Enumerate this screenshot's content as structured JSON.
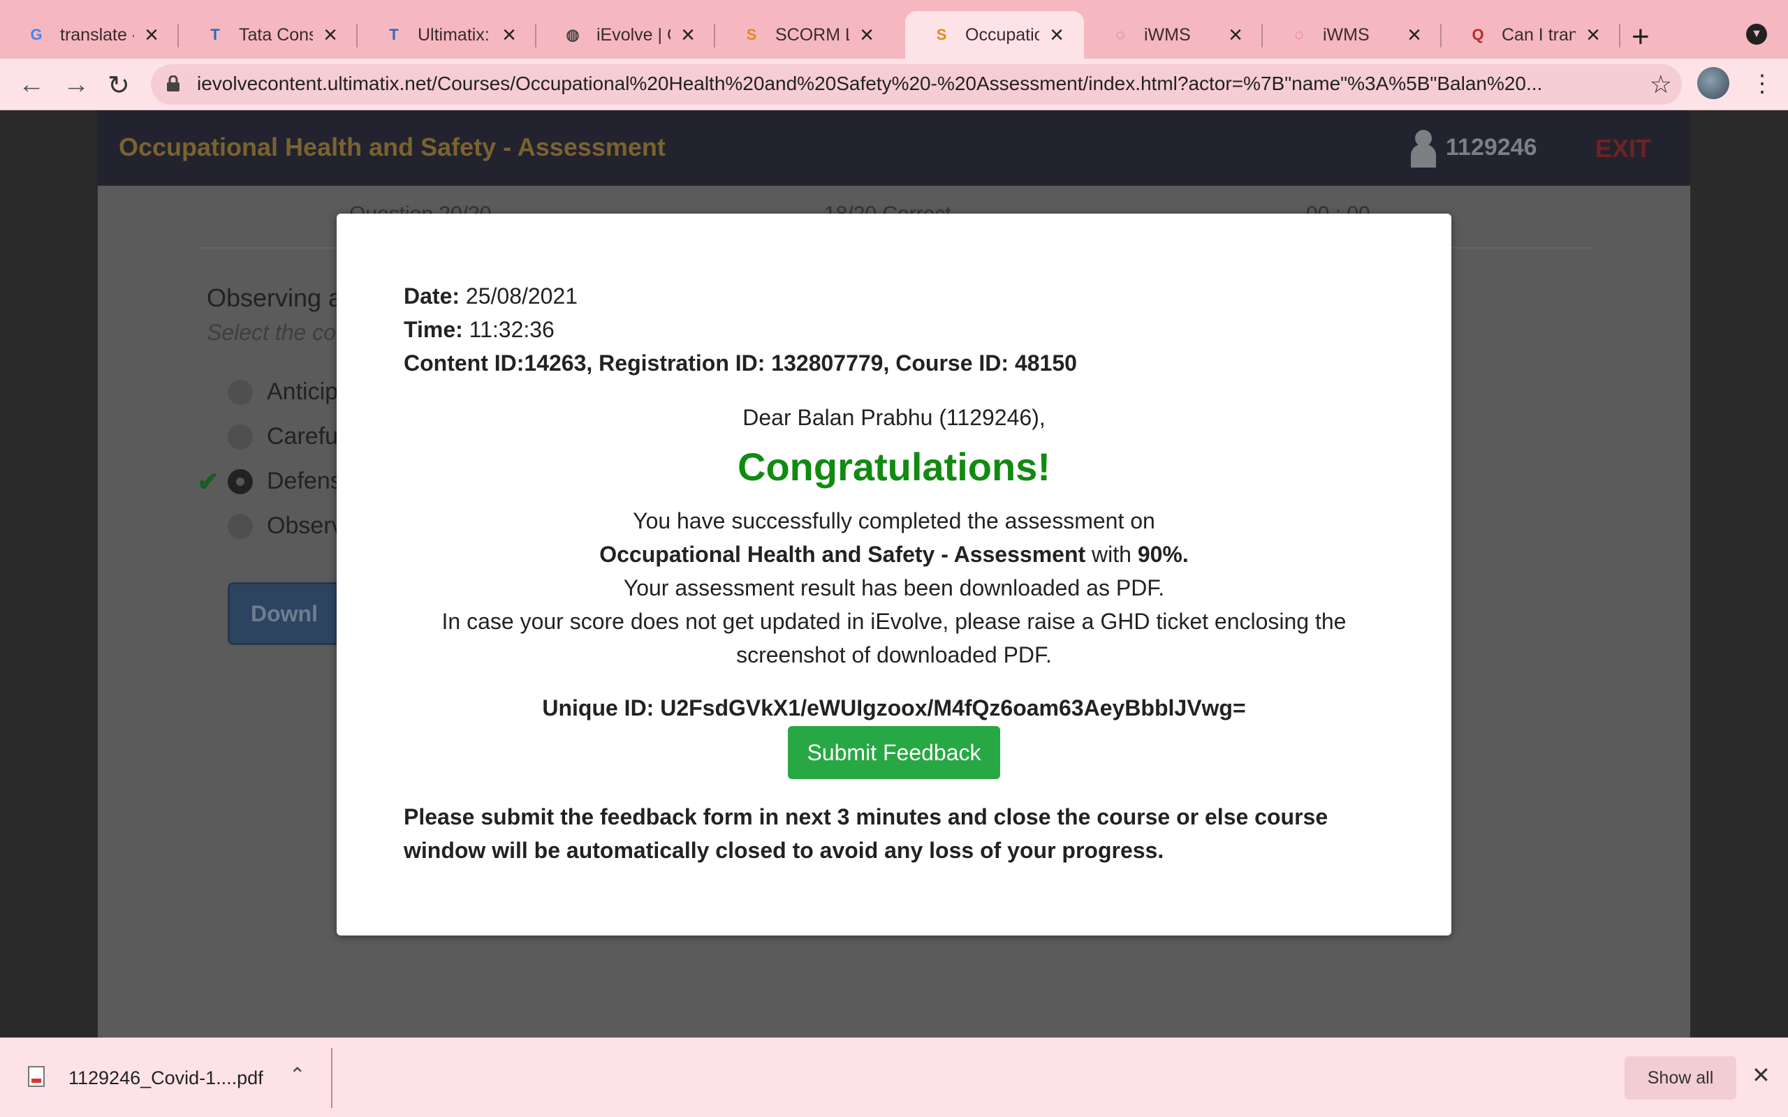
{
  "browser": {
    "tabs": [
      {
        "title": "translate - G",
        "icon": "google-icon",
        "color": "#4285f4",
        "glyph": "G"
      },
      {
        "title": "Tata Consu",
        "icon": "tata-icon",
        "color": "#2b6cb0",
        "glyph": "T"
      },
      {
        "title": "Ultimatix: D",
        "icon": "tata-icon",
        "color": "#2b6cb0",
        "glyph": "T"
      },
      {
        "title": "iEvolve | Co",
        "icon": "globe-icon",
        "color": "#444444",
        "glyph": "◍"
      },
      {
        "title": "SCORM Lau",
        "icon": "scorm-icon",
        "color": "#e08a1c",
        "glyph": "S"
      },
      {
        "title": "Occupation",
        "icon": "scorm-icon",
        "color": "#e08a1c",
        "glyph": "S",
        "active": true
      },
      {
        "title": "iWMS",
        "icon": "iwms-icon",
        "color": "#d44fa0",
        "glyph": "◌"
      },
      {
        "title": "iWMS",
        "icon": "iwms-icon",
        "color": "#d44fa0",
        "glyph": "◌"
      },
      {
        "title": "Can I trans",
        "icon": "quora-icon",
        "color": "#b92b27",
        "glyph": "Q"
      }
    ],
    "url": "ievolvecontent.ultimatix.net/Courses/Occupational%20Health%20and%20Safety%20-%20Assessment/index.html?actor=%7B\"name\"%3A%5B\"Balan%20..."
  },
  "course": {
    "title": "Occupational Health and Safety - Assessment",
    "user_id": "1129246",
    "exit_label": "EXIT",
    "stats": [
      "Question 20/20",
      "18/20 Correct",
      "00 : 00"
    ],
    "question": "Observing a",
    "hint": "Select the co",
    "options": [
      "Anticipa",
      "Careful",
      "Defensi",
      "Observ"
    ],
    "download_label": "Downl"
  },
  "modal": {
    "date_label": "Date:",
    "date_value": "25/08/2021",
    "time_label": "Time:",
    "time_value": "11:32:36",
    "ids": "Content ID:14263, Registration ID: 132807779, Course ID: 48150",
    "greeting": "Dear Balan Prabhu (1129246),",
    "congrats": "Congratulations!",
    "line1": "You have successfully completed the assessment on",
    "course_name": "Occupational Health and Safety - Assessment",
    "with_text": "with",
    "score": "90%.",
    "line3": "Your assessment result has been downloaded as PDF.",
    "line4": "In case your score does not get updated in iEvolve, please raise a GHD ticket enclosing the",
    "line5": "screenshot of downloaded PDF.",
    "unique_id": "Unique ID: U2FsdGVkX1/eWUIgzoox/M4fQz6oam63AeyBbblJVwg=",
    "submit_label": "Submit Feedback",
    "note": "Please submit the feedback form in next 3 minutes and close the course or else course window will be automatically closed to avoid any loss of your progress."
  },
  "downloads": {
    "file_name": "1129246_Covid-1....pdf",
    "show_all_label": "Show all"
  }
}
